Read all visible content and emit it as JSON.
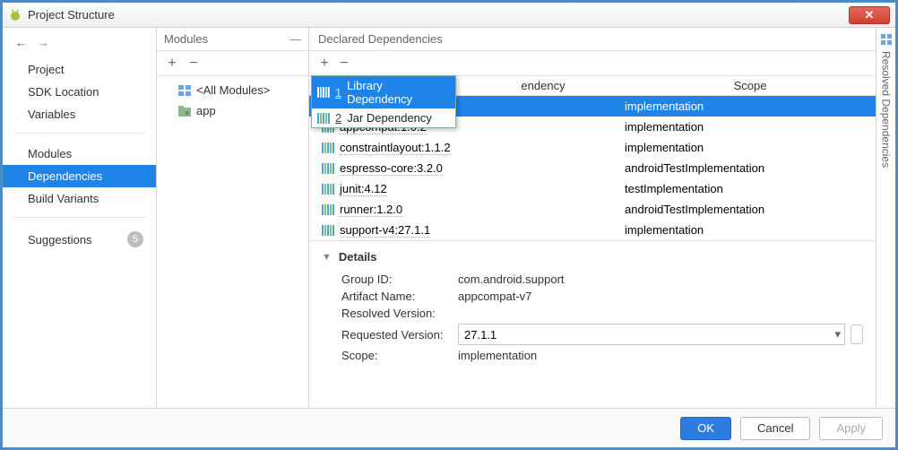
{
  "window": {
    "title": "Project Structure"
  },
  "sidebar": {
    "group1": [
      "Project",
      "SDK Location",
      "Variables"
    ],
    "group2": [
      "Modules",
      "Dependencies",
      "Build Variants"
    ],
    "selected": "Dependencies",
    "suggestions": {
      "label": "Suggestions",
      "count": "5"
    }
  },
  "modules": {
    "header": "Modules",
    "items": [
      {
        "label": "<All Modules>",
        "kind": "all"
      },
      {
        "label": "app",
        "kind": "module"
      }
    ]
  },
  "declared": {
    "header": "Declared Dependencies",
    "columns": {
      "dep": "endency",
      "scope": "Scope"
    },
    "dropdown": [
      {
        "num": "1",
        "label": "Library Dependency",
        "selected": true
      },
      {
        "num": "2",
        "label": "Jar Dependency",
        "selected": false
      }
    ],
    "rows": [
      {
        "name": "",
        "scope": "implementation",
        "selected": true
      },
      {
        "name": "appcompat:1.0.2",
        "scope": "implementation"
      },
      {
        "name": "constraintlayout:1.1.2",
        "scope": "implementation"
      },
      {
        "name": "espresso-core:3.2.0",
        "scope": "androidTestImplementation"
      },
      {
        "name": "junit:4.12",
        "scope": "testImplementation"
      },
      {
        "name": "runner:1.2.0",
        "scope": "androidTestImplementation"
      },
      {
        "name": "support-v4:27.1.1",
        "scope": "implementation"
      }
    ]
  },
  "details": {
    "header": "Details",
    "group_id": {
      "k": "Group ID:",
      "v": "com.android.support"
    },
    "artifact": {
      "k": "Artifact Name:",
      "v": "appcompat-v7"
    },
    "resolved": {
      "k": "Resolved Version:",
      "v": ""
    },
    "requested": {
      "k": "Requested Version:",
      "v": "27.1.1"
    },
    "scope": {
      "k": "Scope:",
      "v": "implementation"
    }
  },
  "rail": {
    "label": "Resolved Dependencies"
  },
  "footer": {
    "ok": "OK",
    "cancel": "Cancel",
    "apply": "Apply"
  },
  "icons": {
    "plus": "+",
    "minus": "−"
  }
}
